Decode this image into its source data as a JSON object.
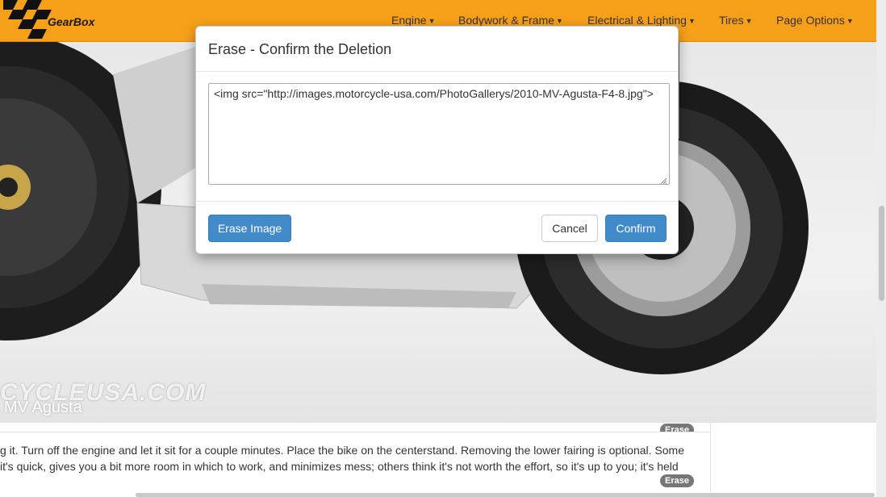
{
  "navbar": {
    "brand": "GearBox",
    "menu": [
      {
        "label": "Engine"
      },
      {
        "label": "Bodywork & Frame"
      },
      {
        "label": "Electrical & Lighting"
      },
      {
        "label": "Tires"
      },
      {
        "label": "Page Options"
      }
    ]
  },
  "photo": {
    "watermark": "CYCLEUSA.COM",
    "caption": "MV Agusta"
  },
  "content": {
    "line1": "g it. Turn off the engine and let it sit for a couple minutes. Place the bike on the centerstand. Removing the lower fairing is optional. Some",
    "line2": "it's quick, gives you a bit more room in which to work, and minimizes mess; others think it's not worth the effort, so it's up to you; it's held",
    "erase_badge_top": "Erase",
    "erase_badge_bottom": "Erase"
  },
  "modal": {
    "title": "Erase - Confirm the Deletion",
    "textarea_value": "<img src=\"http://images.motorcycle-usa.com/PhotoGallerys/2010-MV-Agusta-F4-8.jpg\">",
    "erase_image_label": "Erase Image",
    "cancel_label": "Cancel",
    "confirm_label": "Confirm"
  },
  "colors": {
    "navbar": "#f6a01a",
    "primary": "#428bca",
    "badge": "#777777"
  }
}
